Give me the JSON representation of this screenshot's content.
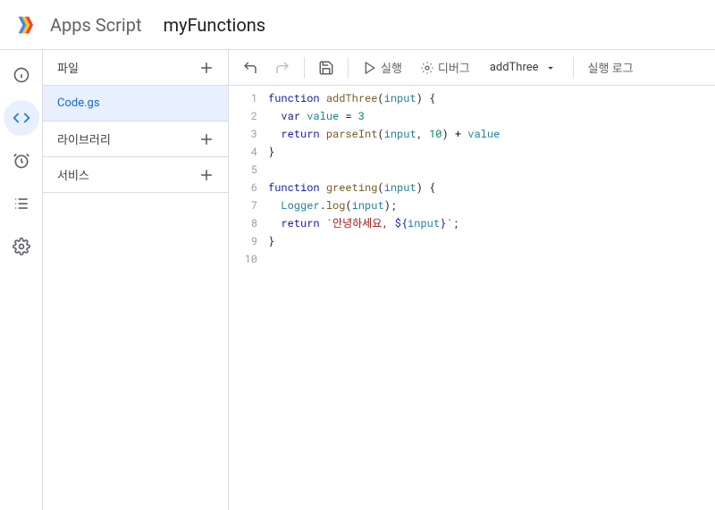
{
  "header": {
    "app_title": "Apps Script",
    "project_title": "myFunctions"
  },
  "leftbar": {
    "items": [
      {
        "name": "overview",
        "icon": "info"
      },
      {
        "name": "editor",
        "icon": "code",
        "active": true
      },
      {
        "name": "triggers",
        "icon": "alarm"
      },
      {
        "name": "executions",
        "icon": "list"
      },
      {
        "name": "settings",
        "icon": "gear"
      }
    ]
  },
  "sidebar": {
    "files_label": "파일",
    "files": [
      {
        "name": "Code.gs",
        "active": true
      }
    ],
    "libraries_label": "라이브러리",
    "services_label": "서비스"
  },
  "toolbar": {
    "run_label": "실행",
    "debug_label": "디버그",
    "function_selected": "addThree",
    "log_label": "실행 로그"
  },
  "editor": {
    "line_count": 10,
    "lines": [
      {
        "n": 1,
        "tokens": [
          {
            "t": "function ",
            "c": "kw"
          },
          {
            "t": "addThree",
            "c": "fn"
          },
          {
            "t": "(",
            "c": ""
          },
          {
            "t": "input",
            "c": "nm"
          },
          {
            "t": ") {",
            "c": ""
          }
        ]
      },
      {
        "n": 2,
        "tokens": [
          {
            "t": "  ",
            "c": ""
          },
          {
            "t": "var ",
            "c": "kw"
          },
          {
            "t": "value",
            "c": "nm"
          },
          {
            "t": " = ",
            "c": ""
          },
          {
            "t": "3",
            "c": "num"
          }
        ]
      },
      {
        "n": 3,
        "tokens": [
          {
            "t": "  ",
            "c": ""
          },
          {
            "t": "return ",
            "c": "kw"
          },
          {
            "t": "parseInt",
            "c": "fn"
          },
          {
            "t": "(",
            "c": ""
          },
          {
            "t": "input",
            "c": "nm"
          },
          {
            "t": ", ",
            "c": ""
          },
          {
            "t": "10",
            "c": "num"
          },
          {
            "t": ") + ",
            "c": ""
          },
          {
            "t": "value",
            "c": "nm"
          }
        ]
      },
      {
        "n": 4,
        "tokens": [
          {
            "t": "}",
            "c": ""
          }
        ]
      },
      {
        "n": 5,
        "tokens": []
      },
      {
        "n": 6,
        "tokens": [
          {
            "t": "function ",
            "c": "kw"
          },
          {
            "t": "greeting",
            "c": "fn"
          },
          {
            "t": "(",
            "c": ""
          },
          {
            "t": "input",
            "c": "nm"
          },
          {
            "t": ") {",
            "c": ""
          }
        ]
      },
      {
        "n": 7,
        "tokens": [
          {
            "t": "  ",
            "c": ""
          },
          {
            "t": "Logger",
            "c": "typ"
          },
          {
            "t": ".",
            "c": ""
          },
          {
            "t": "log",
            "c": "fn"
          },
          {
            "t": "(",
            "c": ""
          },
          {
            "t": "input",
            "c": "nm"
          },
          {
            "t": ");",
            "c": ""
          }
        ]
      },
      {
        "n": 8,
        "tokens": [
          {
            "t": "  ",
            "c": ""
          },
          {
            "t": "return ",
            "c": "kw"
          },
          {
            "t": "`안녕하세요, ",
            "c": "str"
          },
          {
            "t": "${",
            "c": "kw"
          },
          {
            "t": "input",
            "c": "nm"
          },
          {
            "t": "}",
            "c": "kw"
          },
          {
            "t": "`",
            "c": "str"
          },
          {
            "t": ";",
            "c": ""
          }
        ]
      },
      {
        "n": 9,
        "tokens": [
          {
            "t": "}",
            "c": ""
          }
        ]
      },
      {
        "n": 10,
        "tokens": []
      }
    ]
  }
}
